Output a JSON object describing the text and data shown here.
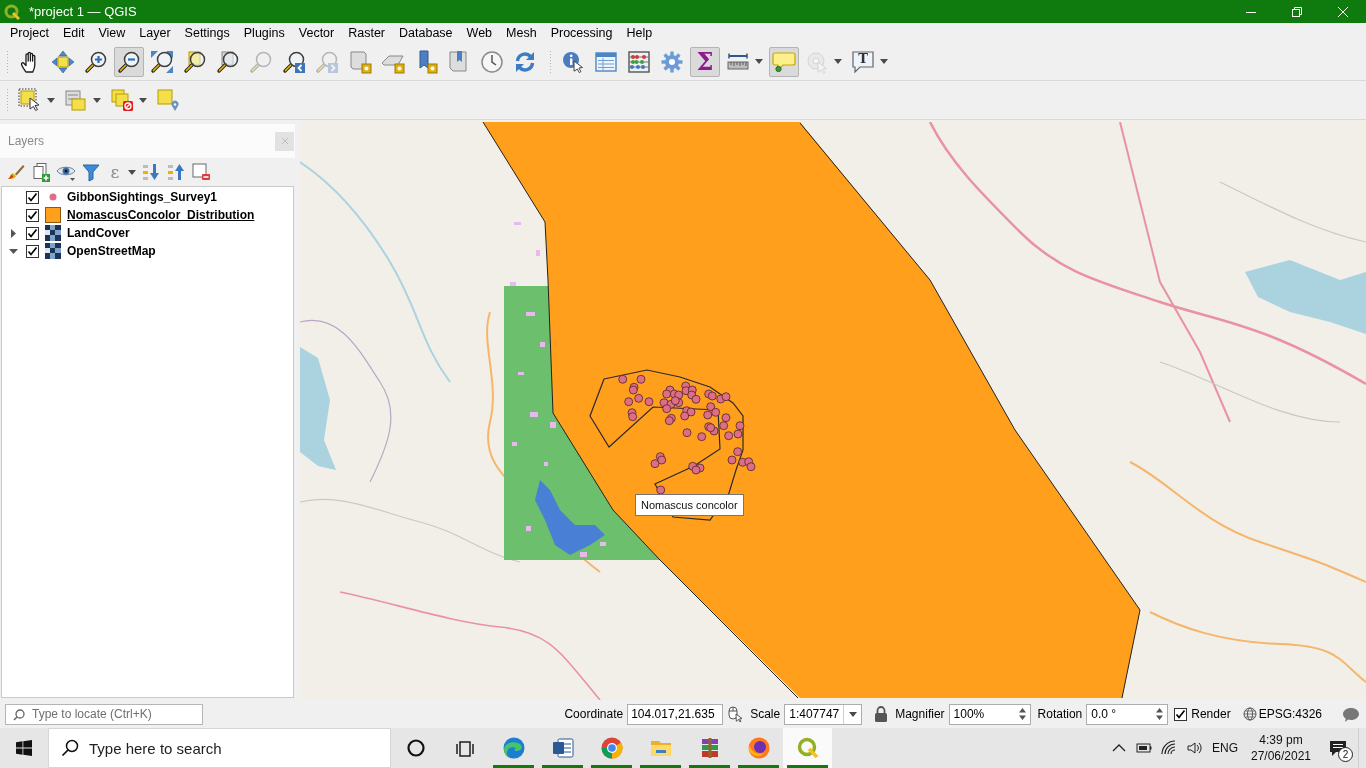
{
  "window": {
    "title": "*project 1 — QGIS"
  },
  "menu_bar": [
    "Project",
    "Edit",
    "View",
    "Layer",
    "Settings",
    "Plugins",
    "Vector",
    "Raster",
    "Database",
    "Web",
    "Mesh",
    "Processing",
    "Help"
  ],
  "map_toolbar": [
    {
      "pressed": false,
      "disabled": false
    },
    {
      "pressed": false,
      "disabled": false
    },
    {
      "pressed": false,
      "disabled": false
    },
    {
      "pressed": true,
      "disabled": false
    },
    {
      "pressed": false,
      "disabled": false
    },
    {
      "pressed": false,
      "disabled": false
    },
    {
      "pressed": false,
      "disabled": false
    },
    {
      "pressed": false,
      "disabled": true
    },
    {
      "pressed": false,
      "disabled": false
    },
    {
      "pressed": false,
      "disabled": true
    },
    {
      "pressed": false,
      "disabled": false
    },
    {
      "pressed": false,
      "disabled": false
    },
    {
      "pressed": false,
      "disabled": false
    },
    {
      "pressed": false,
      "disabled": false
    },
    {
      "pressed": false,
      "disabled": false
    },
    {
      "pressed": false,
      "disabled": false
    },
    {
      "pressed": false,
      "disabled": false
    },
    {
      "pressed": false,
      "disabled": false
    },
    {
      "pressed": false,
      "disabled": false
    },
    {
      "pressed": false,
      "disabled": false
    },
    {
      "pressed": true,
      "disabled": false,
      "glyph": "Σ"
    },
    {
      "pressed": false,
      "disabled": false
    },
    {
      "pressed": true,
      "disabled": false
    },
    {
      "pressed": false,
      "disabled": true
    },
    {
      "pressed": false,
      "disabled": false,
      "glyph": "T"
    }
  ],
  "layers_panel": {
    "title": "Layers",
    "toolbar": [
      {
        "disabled": false
      },
      {
        "disabled": false
      },
      {
        "disabled": false
      },
      {
        "disabled": false
      },
      {
        "disabled": true,
        "glyph": "ε"
      },
      {
        "disabled": false
      },
      {
        "disabled": false
      },
      {
        "disabled": false
      }
    ],
    "layers": [
      {
        "name": "GibbonSightings_Survey1",
        "kind": "point",
        "color": "#e06c86",
        "checked": true,
        "underlined": false
      },
      {
        "name": "NomascusConcolor_Distribution",
        "kind": "polygon",
        "color": "#ff9f1c",
        "checked": true,
        "underlined": true
      },
      {
        "name": "LandCover",
        "kind": "raster",
        "checked": true,
        "expanded": false,
        "underlined": false
      },
      {
        "name": "OpenStreetMap",
        "kind": "raster",
        "checked": true,
        "expanded": true,
        "underlined": false
      }
    ]
  },
  "map_canvas": {
    "tooltip": "Nomascus concolor"
  },
  "status_bar": {
    "locate_placeholder": "Type to locate (Ctrl+K)",
    "coordinate_label": "Coordinate",
    "coordinate": "104.017,21.635",
    "scale_label": "Scale",
    "scale": "1:407747",
    "magnifier_label": "Magnifier",
    "magnifier": "100%",
    "rotation_label": "Rotation",
    "rotation": "0.0 °",
    "render_checked": true,
    "render_label": "Render",
    "crs": "EPSG:4326"
  },
  "taskbar": {
    "search_placeholder": "Type here to search",
    "apps": [
      {
        "running": true,
        "selected": false
      },
      {
        "running": true,
        "selected": false
      },
      {
        "running": true,
        "selected": false
      },
      {
        "running": true,
        "selected": false
      },
      {
        "running": true,
        "selected": false
      },
      {
        "running": true,
        "selected": false
      },
      {
        "running": true,
        "selected": true
      }
    ],
    "language": "ENG",
    "time": "4:39 pm",
    "date": "27/06/2021",
    "notifications": "2"
  }
}
